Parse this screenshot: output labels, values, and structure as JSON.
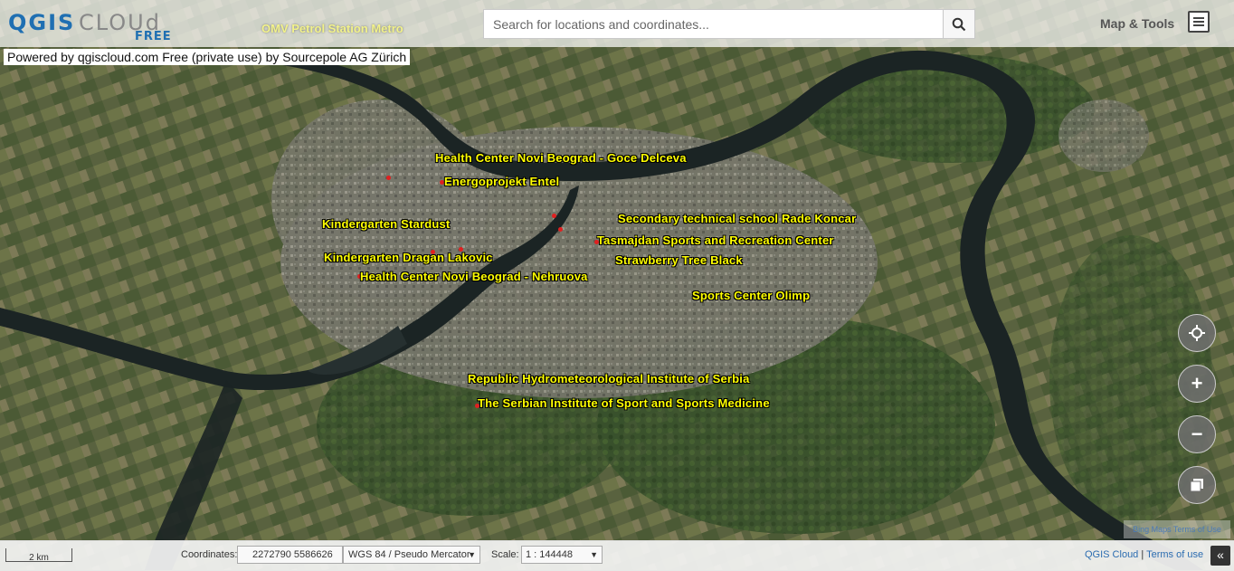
{
  "logo": {
    "brand": "QGIS",
    "product": "CLOUd",
    "tier": "FREE"
  },
  "map_title": "OMV Petrol Station Metro",
  "search": {
    "placeholder": "Search for locations and coordinates..."
  },
  "header": {
    "maptools_label": "Map & Tools"
  },
  "attribution": "Powered by qgiscloud.com Free (private use) by Sourcepole AG Zürich",
  "labels": [
    "Health Center Novi Beograd - Goce Delceva",
    "Energoprojekt Entel",
    "Kindergarten Stardust",
    "Secondary technical school Rade Koncar",
    "Tasmajdan Sports and Recreation Center",
    "Kindergarten Dragan Lakovic",
    "Strawberry Tree Black",
    "Health Center Novi Beograd - Nehruova",
    "Sports Center Olimp",
    "Republic Hydrometeorological Institute of Serbia",
    "The Serbian Institute of Sport and Sports Medicine"
  ],
  "controls": {
    "locate": "crosshair-icon",
    "zoom_in": "+",
    "zoom_out": "−",
    "layers": "layers-icon"
  },
  "bing": "Bing Maps Terms of Use",
  "bottom": {
    "scalebar": "2 km",
    "coordinates_label": "Coordinates:",
    "coordinates_value": "2272790 5586626",
    "crs": "WGS 84 / Pseudo Mercator",
    "scale_label": "Scale:",
    "scale_value": "1 : 144448",
    "link_cloud": "QGIS Cloud",
    "link_sep": " | ",
    "link_terms": "Terms of use",
    "collapse": "«"
  }
}
